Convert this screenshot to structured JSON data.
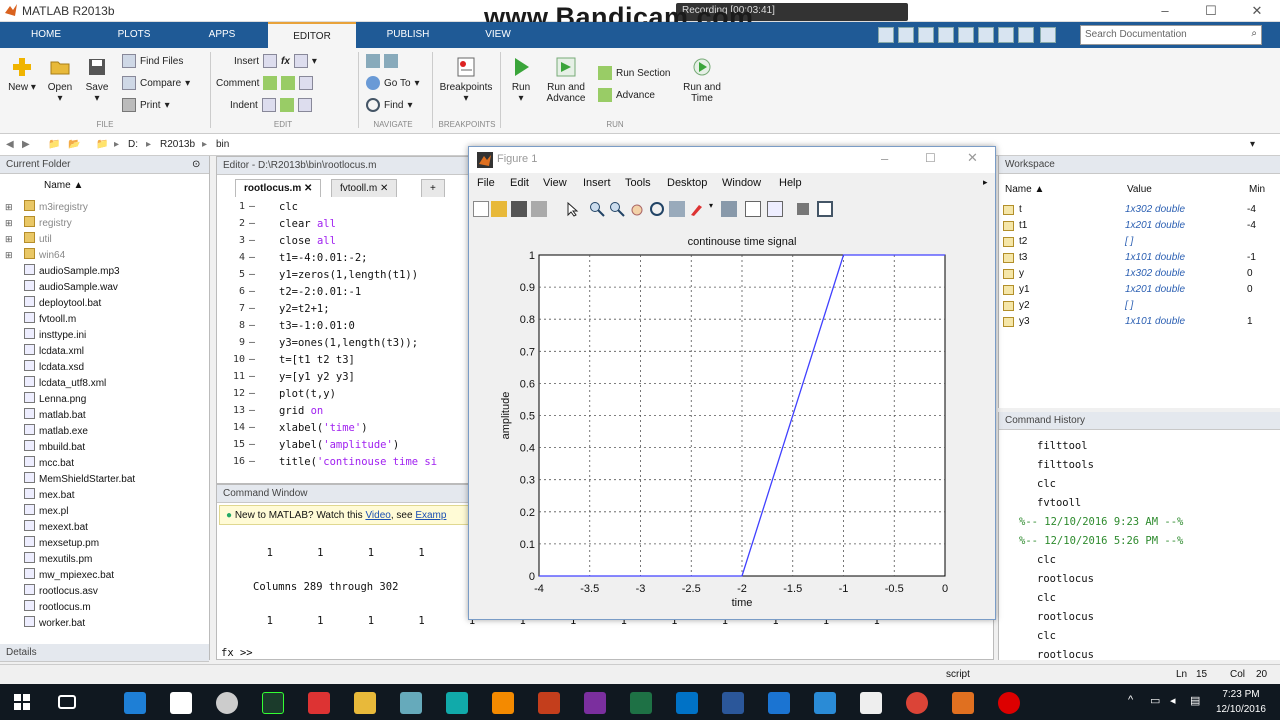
{
  "window": {
    "title": "MATLAB R2013b",
    "controls": [
      "–",
      "☐",
      "✕"
    ]
  },
  "watermark": "www.Bandicam.com",
  "recording": "Recording [00:03:41]",
  "tabs": [
    "HOME",
    "PLOTS",
    "APPS",
    "EDITOR",
    "PUBLISH",
    "VIEW"
  ],
  "search": {
    "placeholder": "Search Documentation"
  },
  "toolstrip": {
    "file": {
      "new": "New",
      "open": "Open",
      "save": "Save",
      "find_files": "Find Files",
      "compare": "Compare",
      "print": "Print",
      "section": "FILE"
    },
    "edit": {
      "insert": "Insert",
      "comment": "Comment",
      "indent": "Indent",
      "section": "EDIT"
    },
    "navigate": {
      "goto": "Go To",
      "find": "Find",
      "section": "NAVIGATE"
    },
    "breakpoints": {
      "label": "Breakpoints",
      "section": "BREAKPOINTS"
    },
    "run": {
      "run": "Run",
      "run_advance": "Run and Advance",
      "run_section": "Run Section",
      "advance": "Advance",
      "run_time": "Run and Time",
      "section": "RUN"
    }
  },
  "address": {
    "drive": "D:",
    "folder1": "R2013b",
    "folder2": "bin"
  },
  "current_folder": {
    "title": "Current Folder",
    "column": "Name ▲",
    "items": [
      "m3iregistry",
      "registry",
      "util",
      "win64",
      "audioSample.mp3",
      "audioSample.wav",
      "deploytool.bat",
      "fvtooll.m",
      "insttype.ini",
      "lcdata.xml",
      "lcdata.xsd",
      "lcdata_utf8.xml",
      "Lenna.png",
      "matlab.bat",
      "matlab.exe",
      "mbuild.bat",
      "mcc.bat",
      "MemShieldStarter.bat",
      "mex.bat",
      "mex.pl",
      "mexext.bat",
      "mexsetup.pm",
      "mexutils.pm",
      "mw_mpiexec.bat",
      "rootlocus.asv",
      "rootlocus.m",
      "worker.bat"
    ],
    "details": "Details"
  },
  "editor": {
    "title": "Editor - D:\\R2013b\\bin\\rootlocus.m",
    "tabs": [
      "rootlocus.m",
      "fvtooll.m",
      "+"
    ],
    "lines": [
      {
        "n": "1",
        "code": "clc"
      },
      {
        "n": "2",
        "code": "clear all"
      },
      {
        "n": "3",
        "code": "close all"
      },
      {
        "n": "4",
        "code": "t1=-4:0.01:-2;"
      },
      {
        "n": "5",
        "code": "y1=zeros(1,length(t1))"
      },
      {
        "n": "6",
        "code": "t2=-2:0.01:-1"
      },
      {
        "n": "7",
        "code": "y2=t2+1;"
      },
      {
        "n": "8",
        "code": "t3=-1:0.01:0"
      },
      {
        "n": "9",
        "code": "y3=ones(1,length(t3));"
      },
      {
        "n": "10",
        "code": "t=[t1 t2 t3]"
      },
      {
        "n": "11",
        "code": "y=[y1 y2 y3]"
      },
      {
        "n": "12",
        "code": "plot(t,y)"
      },
      {
        "n": "13",
        "code": "grid on"
      },
      {
        "n": "14",
        "code": "xlabel('time')"
      },
      {
        "n": "15",
        "code": "ylabel('amplitude')"
      },
      {
        "n": "16",
        "code": "title('continouse time si"
      }
    ]
  },
  "command_window": {
    "title": "Command Window",
    "notice": "New to MATLAB? Watch this",
    "notice_link": "Video",
    "notice_tail": ", see",
    "notice_link2": "Examp",
    "row1": "     1       1       1       1       1",
    "cols": "Columns 289 through 302",
    "row2": "     1       1       1       1       1       1       1       1       1       1       1       1       1",
    "prompt": "fx >>"
  },
  "figure": {
    "title": "Figure 1",
    "menu": [
      "File",
      "Edit",
      "View",
      "Insert",
      "Tools",
      "Desktop",
      "Window",
      "Help"
    ]
  },
  "chart_data": {
    "type": "line",
    "title": "continouse time signal",
    "xlabel": "time",
    "ylabel": "amplitude",
    "xlim": [
      -4,
      0
    ],
    "ylim": [
      0,
      1
    ],
    "xticks": [
      "-4",
      "-3.5",
      "-3",
      "-2.5",
      "-2",
      "-1.5",
      "-1",
      "-0.5",
      "0"
    ],
    "yticks": [
      "0",
      "0.1",
      "0.2",
      "0.3",
      "0.4",
      "0.5",
      "0.6",
      "0.7",
      "0.8",
      "0.9",
      "1"
    ],
    "grid": true,
    "series": [
      {
        "x": [
          -4,
          -2,
          -1,
          0
        ],
        "y": [
          0,
          0,
          1,
          1
        ],
        "color": "#4040ff"
      }
    ]
  },
  "workspace": {
    "title": "Workspace",
    "columns": [
      "Name ▲",
      "Value",
      "Min"
    ],
    "vars": [
      {
        "name": "t",
        "value": "1x302 double",
        "min": "-4"
      },
      {
        "name": "t1",
        "value": "1x201 double",
        "min": "-4"
      },
      {
        "name": "t2",
        "value": "[ ]",
        "min": ""
      },
      {
        "name": "t3",
        "value": "1x101 double",
        "min": "-1"
      },
      {
        "name": "y",
        "value": "1x302 double",
        "min": "0"
      },
      {
        "name": "y1",
        "value": "1x201 double",
        "min": "0"
      },
      {
        "name": "y2",
        "value": "[ ]",
        "min": ""
      },
      {
        "name": "y3",
        "value": "1x101 double",
        "min": "1"
      }
    ]
  },
  "history": {
    "title": "Command History",
    "lines": [
      "filttool",
      "filttools",
      "clc",
      "fvtooll",
      "%-- 12/10/2016 9:23 AM --%",
      "%-- 12/10/2016 5:26 PM --%",
      "clc",
      "rootlocus",
      "clc",
      "rootlocus",
      "clc",
      "rootlocus"
    ]
  },
  "status": {
    "mode": "script",
    "ln_label": "Ln",
    "ln": "15",
    "col_label": "Col",
    "col": "20"
  },
  "clock": {
    "time": "7:23 PM",
    "date": "12/10/2016"
  },
  "colors": {
    "tabstrip": "#1f5a96",
    "plot_line": "#4040ff",
    "keyword": "#a020f0",
    "history_session": "#2e8b2e"
  }
}
